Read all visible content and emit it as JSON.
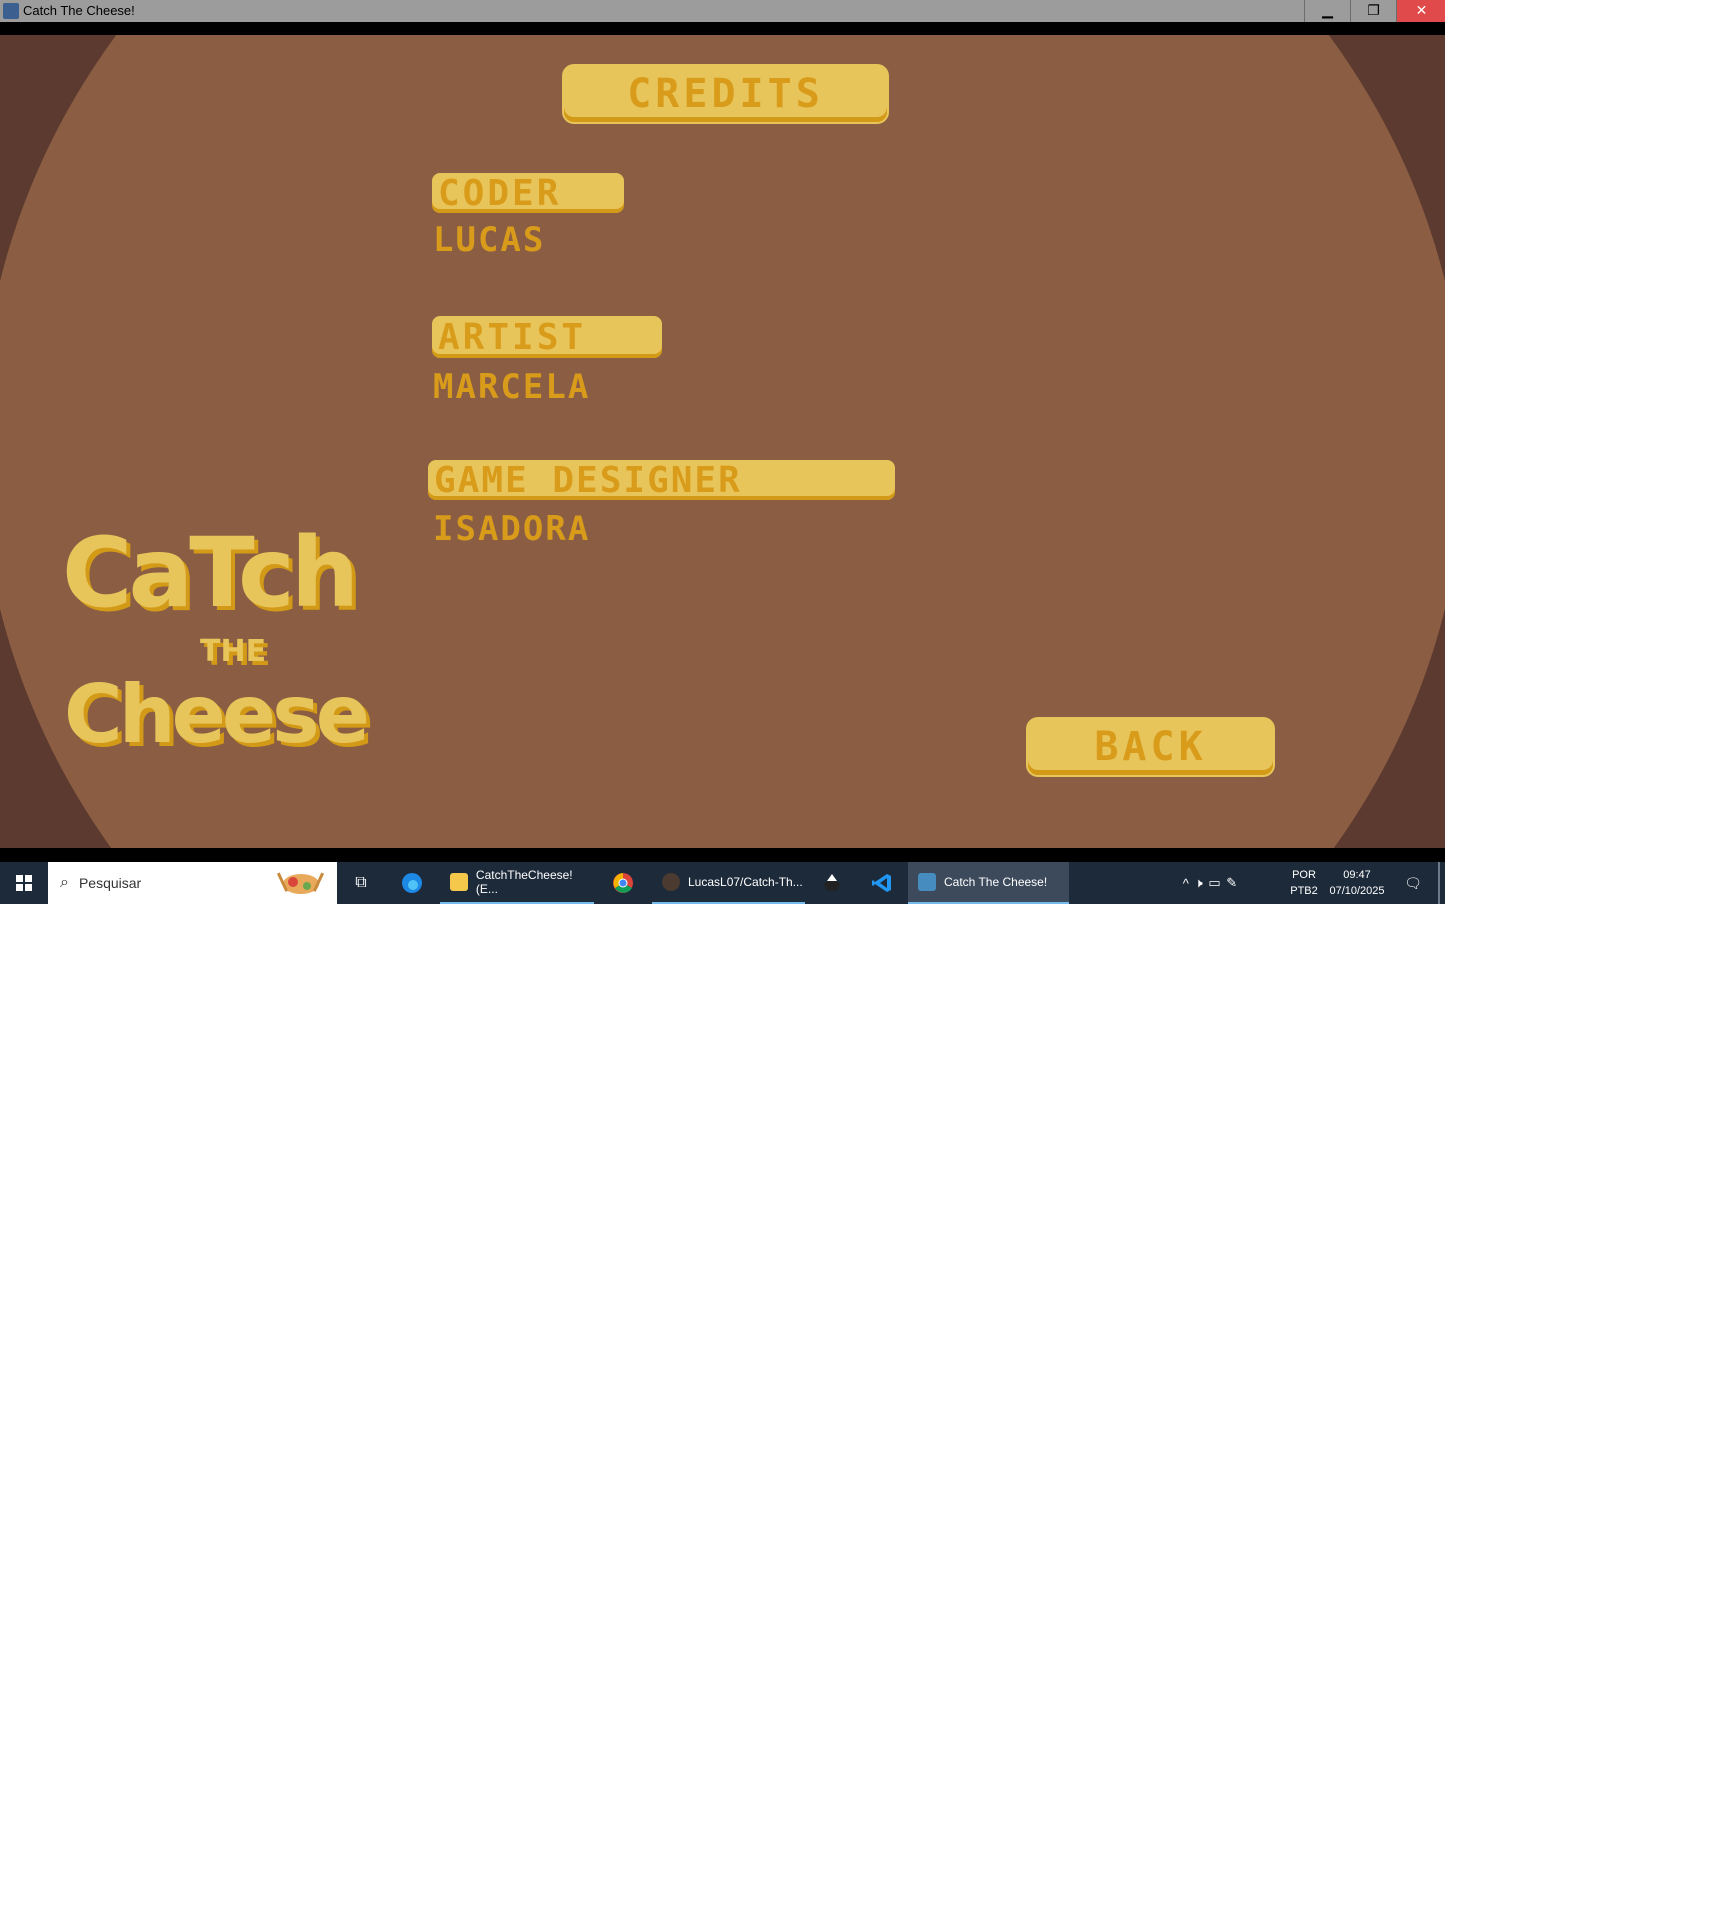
{
  "window": {
    "title": "Catch The Cheese!",
    "minimize_glyph": "▁",
    "maximize_glyph": "❐",
    "close_glyph": "✕"
  },
  "game": {
    "credits_button": "CREDITS",
    "sections": [
      {
        "role": "CODER",
        "name": "LUCAS"
      },
      {
        "role": "ARTIST",
        "name": "MARCELA"
      },
      {
        "role": "GAME DESIGNER",
        "name": "ISADORA"
      }
    ],
    "back_button": "BACK",
    "logo": {
      "line1": "CaTch",
      "line2": "THE",
      "line3": "Cheese"
    },
    "colors": {
      "outer_bg": "#5d3a2f",
      "inner_bg": "#8b5e44",
      "gold": "#e8c55a",
      "gold_dark": "#d29a16",
      "text_gold": "#d99b1a"
    }
  },
  "taskbar": {
    "search_placeholder": "Pesquisar",
    "apps": [
      {
        "label": "CatchTheCheese!(E...",
        "icon": "folder-icon"
      },
      {
        "label": "LucasL07/Catch-Th...",
        "icon": "github-icon"
      },
      {
        "label": "Catch The Cheese!",
        "icon": "godot-icon"
      }
    ],
    "language_line1": "POR",
    "language_line2": "PTB2",
    "time": "09:47",
    "date": "07/10/2025"
  }
}
